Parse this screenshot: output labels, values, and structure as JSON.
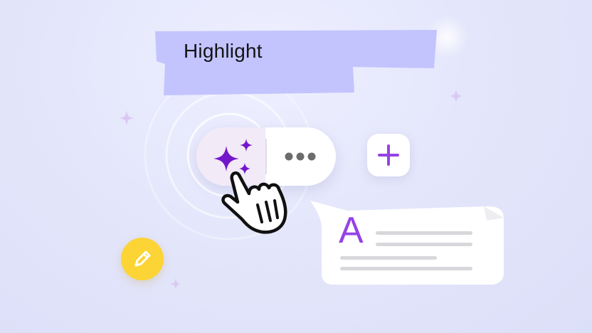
{
  "highlight_tape": {
    "label": "Highlight",
    "color": "#c3c4fd"
  },
  "toggle": {
    "ai_icon": "sparkles-icon",
    "more_icon": "more-horizontal-icon",
    "ai_color": "#7417ca"
  },
  "add_button": {
    "icon": "plus-icon",
    "color": "#9543e3"
  },
  "text_card": {
    "letter": "A",
    "letter_color": "#9543e3"
  },
  "pencil_badge": {
    "icon": "pencil-icon",
    "color": "#fcd435"
  },
  "cursor": {
    "icon": "hand-pointer-icon"
  },
  "decorations": {
    "sparkle_icon": "sparkle-icon",
    "sparkle_color": "#dac9f2"
  }
}
